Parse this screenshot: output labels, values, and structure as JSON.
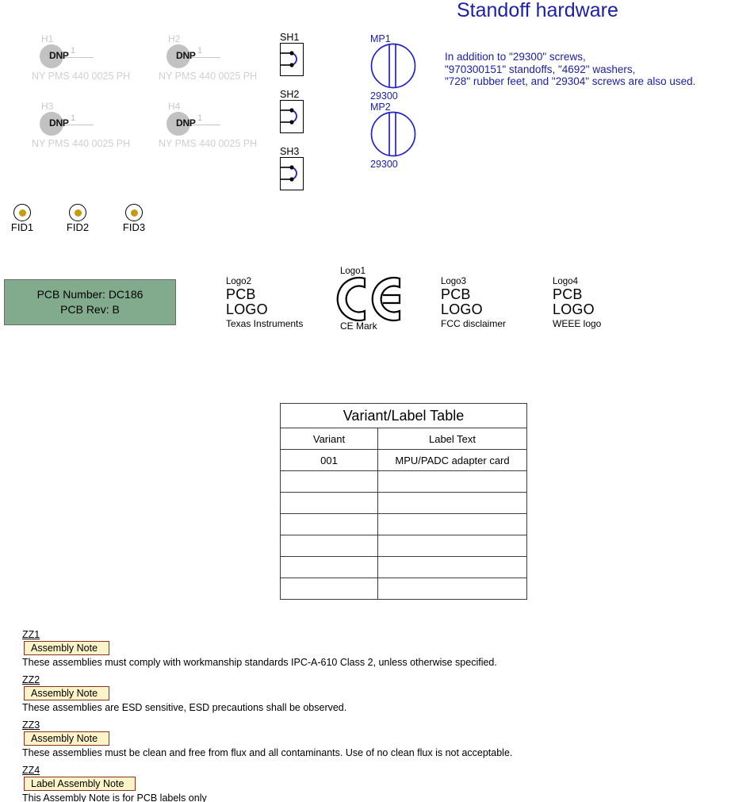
{
  "sheet": {
    "title": "Standoff hardware"
  },
  "mounting_holes": [
    {
      "ref": "H1",
      "dnp_label": "DNP",
      "pin": "1",
      "part": "NY PMS 440 0025 PH"
    },
    {
      "ref": "H2",
      "dnp_label": "DNP",
      "pin": "1",
      "part": "NY PMS 440 0025 PH"
    },
    {
      "ref": "H3",
      "dnp_label": "DNP",
      "pin": "1",
      "part": "NY PMS 440 0025 PH"
    },
    {
      "ref": "H4",
      "dnp_label": "DNP",
      "pin": "1",
      "part": "NY PMS 440 0025 PH"
    }
  ],
  "shields": [
    {
      "ref": "SH1"
    },
    {
      "ref": "SH2"
    },
    {
      "ref": "SH3"
    }
  ],
  "standoffs": [
    {
      "ref": "MP1",
      "part": "29300"
    },
    {
      "ref": "MP2",
      "part": "29300"
    }
  ],
  "standoff_note": {
    "line1": "In addition to \"29300\" screws,",
    "line2": "\"970300151\" standoffs, \"4692\" washers,",
    "line3": "\"728\" rubber feet, and \"29304\" screws are also used."
  },
  "fiducials": [
    {
      "label": "FID1"
    },
    {
      "label": "FID2"
    },
    {
      "label": "FID3"
    }
  ],
  "pcb_info": {
    "number_line": "PCB Number: DC186",
    "rev_line": "PCB Rev: B"
  },
  "logos": {
    "logo2": {
      "ref": "Logo2",
      "line1": "PCB",
      "line2": "LOGO",
      "sub": "Texas Instruments"
    },
    "logo1": {
      "ref": "Logo1",
      "sub": "CE Mark"
    },
    "logo3": {
      "ref": "Logo3",
      "line1": "PCB",
      "line2": "LOGO",
      "sub": "FCC disclaimer"
    },
    "logo4": {
      "ref": "Logo4",
      "line1": "PCB",
      "line2": "LOGO",
      "sub": "WEEE logo"
    }
  },
  "variant_table": {
    "title": "Variant/Label Table",
    "headers": [
      "Variant",
      "Label Text"
    ],
    "rows": [
      [
        "001",
        "MPU/PADC adapter card"
      ],
      [
        "",
        ""
      ],
      [
        "",
        ""
      ],
      [
        "",
        ""
      ],
      [
        "",
        ""
      ],
      [
        "",
        ""
      ],
      [
        "",
        ""
      ]
    ]
  },
  "assembly_notes": [
    {
      "ref": "ZZ1",
      "badge": "Assembly Note",
      "text": "These assemblies must comply with workmanship standards IPC-A-610 Class 2, unless otherwise specified."
    },
    {
      "ref": "ZZ2",
      "badge": "Assembly Note",
      "text": "These assemblies are ESD sensitive, ESD precautions shall be observed."
    },
    {
      "ref": "ZZ3",
      "badge": "Assembly Note",
      "text": "These assemblies must be clean and free from flux and all contaminants. Use of no clean flux is not acceptable."
    },
    {
      "ref": "ZZ4",
      "badge": "Label Assembly Note",
      "text": "This Assembly Note is for PCB labels only"
    }
  ],
  "colors": {
    "title_blue": "#1c21a8",
    "symbol_blue": "#2222cc",
    "dnp_gray": "#c2c2c2",
    "pcb_box_green": "#82ab8e",
    "fiducial_gold": "#c89a12",
    "note_badge_fill": "#fdf3c8",
    "note_badge_border": "#8c3020"
  }
}
